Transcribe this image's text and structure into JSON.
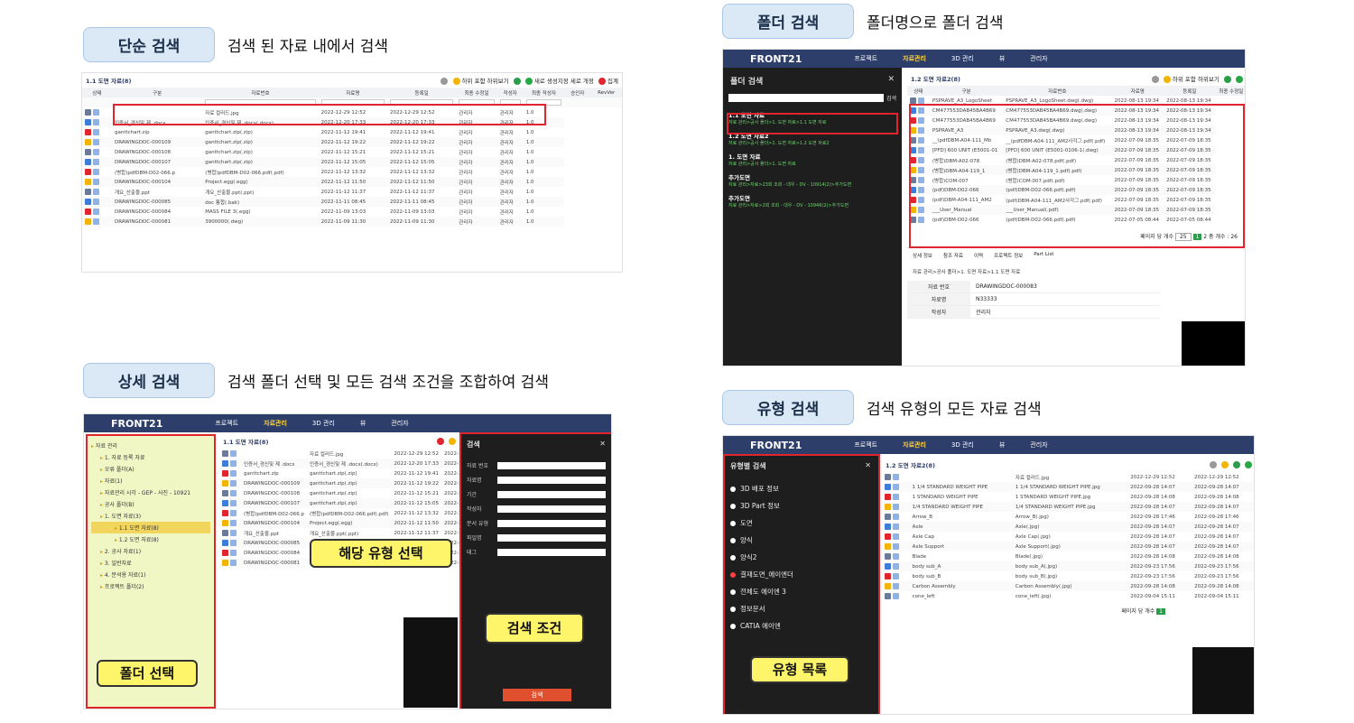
{
  "sections": {
    "simple": {
      "badge": "단순 검색",
      "desc": "검색 된 자료 내에서 검색"
    },
    "folder": {
      "badge": "폴더 검색",
      "desc": "폴더명으로 폴더 검색"
    },
    "detail": {
      "badge": "상세 검색",
      "desc": "검색 폴더 선택 및 모든 검색 조건을 조합하여 검색"
    },
    "type": {
      "badge": "유형 검색",
      "desc": "검색 유형의 모든 자료 검색"
    }
  },
  "app": {
    "logo": "FRONT21",
    "nav": [
      "프로젝트",
      "자료관리",
      "3D 관리",
      "뷰",
      "관리자"
    ],
    "active_nav": "자료관리",
    "list_title_11": "1.1 도면 자료(8)",
    "list_title_12": "1.2 도면 자료2(8)",
    "list_title_12b": "1.2 도면 자료2(8)",
    "tool_labels": [
      "하위 포함",
      "하위보기",
      "새로",
      "생성지정",
      "세로",
      "개정",
      "집계"
    ],
    "columns": [
      "상태",
      "구분",
      "자료번호",
      "자료명",
      "등록일",
      "최종 수정일",
      "작성자",
      "최종 작성자",
      "승인자",
      "RevVer"
    ]
  },
  "simple_rows": [
    [
      "",
      "자료 컬러드.jpg",
      "2022-12-29 12:52",
      "2022-12-29 12:52",
      "관리자",
      "관리자",
      "1.0"
    ],
    [
      "인증서_경신및 제 .docx",
      "인증서_경신및 제 .docx(.docx)",
      "2022-12-20 17:33",
      "2022-12-20 17:33",
      "관리자",
      "관리자",
      "1.0"
    ],
    [
      "ganttchart.zip",
      "ganttchart.zip(.zip)",
      "2022-11-12 19:41",
      "2022-11-12 19:41",
      "관리자",
      "관리자",
      "1.0"
    ],
    [
      "DRAWINGDOC-000109",
      "ganttchart.zip(.zip)",
      "2022-11-12 19:22",
      "2022-11-12 19:22",
      "관리자",
      "관리자",
      "1.0"
    ],
    [
      "DRAWINGDOC-000108",
      "ganttchart.zip(.zip)",
      "2022-11-12 15:21",
      "2022-11-12 15:21",
      "관리자",
      "관리자",
      "1.0"
    ],
    [
      "DRAWINGDOC-000107",
      "ganttchart.zip(.zip)",
      "2022-11-12 15:05",
      "2022-11-12 15:05",
      "관리자",
      "관리자",
      "1.0"
    ],
    [
      "(병합)pdfDBM-D02-066.p",
      "(병합)pdfDBM-D02-066.pdf(.pdf)",
      "2022-11-12 13:32",
      "2022-11-12 13:32",
      "관리자",
      "관리자",
      "1.0"
    ],
    [
      "DRAWINGDOC-000104",
      "Project.egg(.egg)",
      "2022-11-12 11:50",
      "2022-11-12 11:50",
      "관리자",
      "관리자",
      "1.0"
    ],
    [
      "개요_산출물.ppt",
      "개요_산출물.ppt(.ppt)",
      "2022-11-12 11:37",
      "2022-11-12 11:37",
      "관리자",
      "관리자",
      "1.0"
    ],
    [
      "DRAWINGDOC-000085",
      "doc 통합(.bak)",
      "2022-11-11 08:45",
      "2022-11-11 08:45",
      "관리자",
      "관리자",
      "1.0"
    ],
    [
      "DRAWINGDOC-000084",
      "MASS FILE 3(.egg)",
      "2022-11-09 13:03",
      "2022-11-09 13:03",
      "관리자",
      "관리자",
      "1.0"
    ],
    [
      "DRAWINGDOC-000081",
      "3900000(.dwg)",
      "2022-11-09 11:30",
      "2022-11-09 11:30",
      "관리자",
      "관리자",
      "1.0"
    ]
  ],
  "folder_panel": {
    "title": "폴더 검색",
    "search_btn": "검색",
    "items": [
      {
        "name": "1.1 도면 자료",
        "path": "자료 관리>공사 폴더>1. 도면 자료>1.1 도면 자료"
      },
      {
        "name": "1.2 도면 자료2",
        "path": "자료 관리>공사 폴더>1. 도면 자료>1.2 도면 자료2"
      },
      {
        "name": "1. 도면 자료",
        "path": "자료 관리>공사 폴더>1. 도면 자료"
      },
      {
        "name": "추가도면",
        "path": "자료 관리>자료>23회 조회 - 대우 - DV - 10914(2)>추가도면"
      },
      {
        "name": "추가도면",
        "path": "자료 관리>자료>2회 조회 - 대우 - DV - 10946(2)>추가도면"
      }
    ]
  },
  "folder_rows": [
    [
      "PSPRAVE_A3_LogoSheet",
      "PSPRAVE_A3_LogoSheet.dwg(.dwg)",
      "2022-08-13 19:34",
      "2022-08-13 19:34"
    ],
    [
      "CM477553DAB45BA4B69",
      "CM477553DAB45BA4B69.dwg(.dwg)",
      "2022-08-13 19:34",
      "2022-08-13 19:34"
    ],
    [
      "CM477553DAB45BA4B69",
      "CM477553DAB45BA4B69.dwg(.dwg)",
      "2022-08-13 19:34",
      "2022-08-13 19:34"
    ],
    [
      "PSPRAVE_A3",
      "PSPRAVE_A3.dwg(.dwg)",
      "2022-08-13 19:34",
      "2022-08-13 19:34"
    ],
    [
      "__(pdfDBM-A04-111_Mb",
      "__(pdfDBM-A04-111_AM2사각그.pdf(.pdf)",
      "2022-07-09 18:35",
      "2022-07-09 18:35"
    ],
    [
      "[PFD] 600 UNIT (E5001-01",
      "[PFD] 600 UNIT (E5001-0106-1(.dwg)",
      "2022-07-09 18:35",
      "2022-07-09 18:35"
    ],
    [
      "(병합)DBM-A02-078",
      "(병합)DBM-A02-078.pdf(.pdf)",
      "2022-07-09 18:35",
      "2022-07-09 18:35"
    ],
    [
      "(병합)DBM-A04-119_1",
      "(병합)DBM-A04-119_1.pdf(.pdf)",
      "2022-07-09 18:35",
      "2022-07-09 18:35"
    ],
    [
      "(병합)COM-007",
      "(병합)COM-007.pdf(.pdf)",
      "2022-07-09 18:35",
      "2022-07-09 18:35"
    ],
    [
      "(pdf)DBM-D02-066",
      "(pdf)DBM-D02-066.pdf(.pdf)",
      "2022-07-09 18:35",
      "2022-07-09 18:35"
    ],
    [
      "(pdf)DBM-A04-111_AM2",
      "(pdf)DBM-A04-111_AM2사각그.pdf(.pdf)",
      "2022-07-09 18:35",
      "2022-07-09 18:35"
    ],
    [
      "___User_Manual",
      "___User_Manual(.pdf)",
      "2022-07-09 18:35",
      "2022-07-09 18:35"
    ],
    [
      "(pdf)DBM-D02-066",
      "(pdf)DBM-D02-066.pdf(.pdf)",
      "2022-07-05 08:44",
      "2022-07-05 08:44"
    ]
  ],
  "pager": {
    "per_page_label": "페이지 당 개수",
    "per_page": "25",
    "total": "총 개수 : 26"
  },
  "detail_tabs": [
    "상세 정보",
    "참조 자료",
    "이력",
    "프로젝트 정보",
    "Part List"
  ],
  "detail_info": {
    "path": "자료 관리>공사 폴더>1. 도면 자료>1.1 도면 자료",
    "rows": [
      {
        "k": "자료 번호",
        "v": "DRAWINGDOC-000083"
      },
      {
        "k": "자료명",
        "v": "N33333"
      },
      {
        "k": "작성자",
        "v": "관리자"
      }
    ]
  },
  "detail_search": {
    "panel_title": "검색",
    "fields": [
      "자료 번호",
      "자료명",
      "기간",
      "작성자",
      "문서 유형",
      "파일명",
      "태그"
    ],
    "search_btn": "검색",
    "callout_type": "해당 유형 선택",
    "callout_cond": "검색 조건",
    "callout_folder": "폴더 선택",
    "tree": [
      "자료 관리",
      "1. 자료 등록 자료",
      "오류 폴더(A)",
      "자료(1)",
      "자료관리 시각 - GEP - 사진 - 10921",
      "공사 폴더(B)",
      "1. 도면 자료(3)",
      "1.1 도면 자료(8)",
      "1.2 도면 자료(8)",
      "2. 공사 자료(1)",
      "3. 일반자료",
      "4. 분석용 자료(1)",
      "프로젝트 폴더(2)"
    ]
  },
  "type_search": {
    "panel_title": "유형별 검색",
    "items": [
      "3D 배포 정보",
      "3D Part 정보",
      "도면",
      "양식",
      "양식2",
      "결재도면_에이엔더",
      "전체도 에이엔 3",
      "정보문서",
      "CATIA 에이엔"
    ],
    "selected": "결재도면_에이엔더",
    "callout": "유형 목록"
  },
  "type_rows": [
    [
      "",
      "자료 컬러드.jpg",
      "2022-12-29 12:52",
      "2022-12-29 12:52"
    ],
    [
      "1 1/4 STANDARD WEIGHT PIPE",
      "1 1/4 STANDARD WEIGHT PIPE.jpg",
      "2022-09-28 14:07",
      "2022-09-28 14:07"
    ],
    [
      "1 STANDARD WEIGHT PIPE",
      "1 STANDARD WEIGHT PIPE.jpg",
      "2022-09-28 14:08",
      "2022-09-28 14:08"
    ],
    [
      "1/4 STANDARD WEIGHT PIPE",
      "1/4 STANDARD WEIGHT PIPE.jpg",
      "2022-09-28 14:07",
      "2022-09-28 14:07"
    ],
    [
      "Arrow_B",
      "Arrow_B(.jpg)",
      "2022-09-28 17:46",
      "2022-09-28 17:46"
    ],
    [
      "Axle",
      "Axle(.jpg)",
      "2022-09-28 14:07",
      "2022-09-28 14:07"
    ],
    [
      "Axle Cap",
      "Axle Cap(.jpg)",
      "2022-09-28 14:07",
      "2022-09-28 14:07"
    ],
    [
      "Axle Support",
      "Axle Support(.jpg)",
      "2022-09-28 14:07",
      "2022-09-28 14:07"
    ],
    [
      "Blade",
      "Blade(.jpg)",
      "2022-09-28 14:08",
      "2022-09-28 14:08"
    ],
    [
      "body sub_A",
      "body sub_A(.jpg)",
      "2022-09-23 17:56",
      "2022-09-23 17:56"
    ],
    [
      "body sub_B",
      "body sub_B(.jpg)",
      "2022-09-23 17:56",
      "2022-09-23 17:56"
    ],
    [
      "Carbon Assembly",
      "Carbon Assembly(.jpg)",
      "2022-09-28 14:08",
      "2022-09-28 14:08"
    ],
    [
      "cone_left",
      "cone_left(.jpg)",
      "2022-09-04 15:11",
      "2022-09-04 15:11"
    ]
  ],
  "colors": {
    "accent_red": "#e0252e",
    "nav_blue": "#2d3e6b",
    "callout_yellow": "#fff56a",
    "tree_green": "#f0f6c4"
  }
}
